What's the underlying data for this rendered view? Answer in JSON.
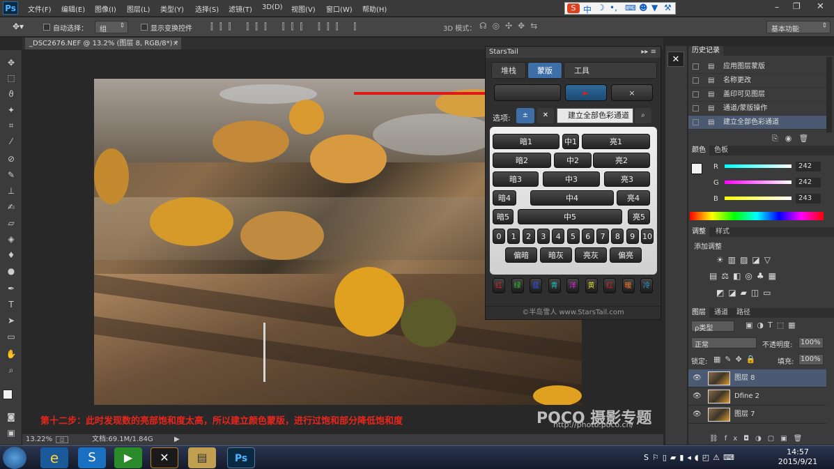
{
  "app": {
    "logo": "Ps"
  },
  "menu": [
    "文件(F)",
    "编辑(E)",
    "图像(I)",
    "图层(L)",
    "类型(Y)",
    "选择(S)",
    "滤镜(T)",
    "3D(D)",
    "视图(V)",
    "窗口(W)",
    "帮助(H)"
  ],
  "ime": {
    "label": "中"
  },
  "options": {
    "auto_select": "自动选择：",
    "auto_select_value": "组",
    "show_transform": "显示变换控件",
    "mode3d": "3D 模式：",
    "workspace": "基本功能"
  },
  "document": {
    "tab": "_DSC2676.NEF @ 13.2% (图层 8, RGB/8*) *"
  },
  "caption": "第十二步：此时发现数的亮部饱和度太高，所以建立颜色蒙版，进行过饱和部分降低饱和度",
  "watermark": {
    "brand": "POCO 摄影专题",
    "url": "http://photo.poco.cn/"
  },
  "status": {
    "zoom": "13.22%",
    "doc": "文档:69.1M/1.84G"
  },
  "starstail": {
    "title": "StarsTail",
    "tabs": [
      "堆栈",
      "蒙版",
      "工具"
    ],
    "active_tab": "蒙版",
    "row_buttons": [
      "",
      "►",
      "×"
    ],
    "options_label": "选项:",
    "tooltip": "建立全部色彩通道",
    "rows": [
      [
        "暗1",
        "中1",
        "亮1"
      ],
      [
        "暗2",
        "中2",
        "亮2"
      ],
      [
        "暗3",
        "中3",
        "亮3"
      ],
      [
        "暗4",
        "中4",
        "亮4"
      ],
      [
        "暗5",
        "中5",
        "亮5"
      ]
    ],
    "numbers": [
      "0",
      "1",
      "2",
      "3",
      "4",
      "5",
      "6",
      "7",
      "8",
      "9",
      "10"
    ],
    "tones": [
      "偏暗",
      "暗灰",
      "亮灰",
      "偏亮"
    ],
    "colors": [
      {
        "label": "红",
        "color": "#e02020"
      },
      {
        "label": "绿",
        "color": "#30c030"
      },
      {
        "label": "蓝",
        "color": "#3050ff"
      },
      {
        "label": "青",
        "color": "#20c0c0"
      },
      {
        "label": "洋",
        "color": "#e020e0"
      },
      {
        "label": "黄",
        "color": "#e0d020"
      },
      {
        "label": "红",
        "color": "#e02020"
      },
      {
        "label": "暖",
        "color": "#ff7020"
      },
      {
        "label": "冷",
        "color": "#20a0e0"
      }
    ],
    "footer": "©半岛雪人 www.StarsTail.com"
  },
  "history": {
    "tabs": [
      "历史记录"
    ],
    "items": [
      "应用图层蒙版",
      "名称更改",
      "盖印可见图层",
      "通道/蒙版操作",
      "建立全部色彩通道"
    ]
  },
  "color_panel": {
    "tabs": [
      "颜色",
      "色板"
    ],
    "r": "242",
    "g": "242",
    "b": "243",
    "labels": [
      "R",
      "G",
      "B"
    ]
  },
  "adjust_panel": {
    "tabs": [
      "调整",
      "样式"
    ],
    "title": "添加调整"
  },
  "layers_panel": {
    "tabs": [
      "图层",
      "通道",
      "路径"
    ],
    "filter": "ρ类型",
    "blend": "正常",
    "opacity_label": "不透明度:",
    "opacity": "100%",
    "lock_label": "锁定:",
    "fill_label": "填充:",
    "fill": "100%",
    "layers": [
      "图层 8",
      "Dfine 2",
      "图层 7"
    ]
  },
  "taskbar": {
    "time": "14:57",
    "date": "2015/9/21"
  }
}
